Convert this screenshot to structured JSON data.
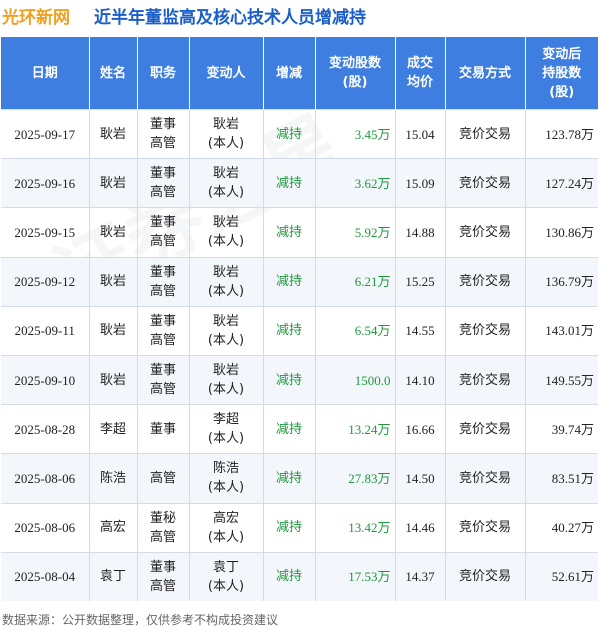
{
  "header": {
    "brand": "光环新网",
    "title": "近半年董监高及核心技术人员增减持"
  },
  "table": {
    "columns": [
      "日期",
      "姓名",
      "职务",
      "变动人",
      "增减",
      "变动股数\n(股)",
      "成交\n均价",
      "交易方式",
      "变动后\n持股数\n(股)"
    ],
    "rows": [
      {
        "date": "2025-09-17",
        "name": "耿岩",
        "role": "董事\n高管",
        "changer": "耿岩\n(本人)",
        "action": "减持",
        "shares": "3.45万",
        "price": "15.04",
        "method": "竞价交易",
        "after": "123.78万"
      },
      {
        "date": "2025-09-16",
        "name": "耿岩",
        "role": "董事\n高管",
        "changer": "耿岩\n(本人)",
        "action": "减持",
        "shares": "3.62万",
        "price": "15.09",
        "method": "竞价交易",
        "after": "127.24万"
      },
      {
        "date": "2025-09-15",
        "name": "耿岩",
        "role": "董事\n高管",
        "changer": "耿岩\n(本人)",
        "action": "减持",
        "shares": "5.92万",
        "price": "14.88",
        "method": "竞价交易",
        "after": "130.86万"
      },
      {
        "date": "2025-09-12",
        "name": "耿岩",
        "role": "董事\n高管",
        "changer": "耿岩\n(本人)",
        "action": "减持",
        "shares": "6.21万",
        "price": "15.25",
        "method": "竞价交易",
        "after": "136.79万"
      },
      {
        "date": "2025-09-11",
        "name": "耿岩",
        "role": "董事\n高管",
        "changer": "耿岩\n(本人)",
        "action": "减持",
        "shares": "6.54万",
        "price": "14.55",
        "method": "竞价交易",
        "after": "143.01万"
      },
      {
        "date": "2025-09-10",
        "name": "耿岩",
        "role": "董事\n高管",
        "changer": "耿岩\n(本人)",
        "action": "减持",
        "shares": "1500.0",
        "price": "14.10",
        "method": "竞价交易",
        "after": "149.55万"
      },
      {
        "date": "2025-08-28",
        "name": "李超",
        "role": "董事",
        "changer": "李超\n(本人)",
        "action": "减持",
        "shares": "13.24万",
        "price": "16.66",
        "method": "竞价交易",
        "after": "39.74万"
      },
      {
        "date": "2025-08-06",
        "name": "陈浩",
        "role": "高管",
        "changer": "陈浩\n(本人)",
        "action": "减持",
        "shares": "27.83万",
        "price": "14.50",
        "method": "竞价交易",
        "after": "83.51万"
      },
      {
        "date": "2025-08-06",
        "name": "高宏",
        "role": "董秘\n高管",
        "changer": "高宏\n(本人)",
        "action": "减持",
        "shares": "13.42万",
        "price": "14.46",
        "method": "竞价交易",
        "after": "40.27万"
      },
      {
        "date": "2025-08-04",
        "name": "袁丁",
        "role": "董事\n高管",
        "changer": "袁丁\n(本人)",
        "action": "减持",
        "shares": "17.53万",
        "price": "14.37",
        "method": "竞价交易",
        "after": "52.61万"
      }
    ]
  },
  "watermark": "证券之星",
  "footer": "数据来源：公开数据整理，仅供参考不构成投资建议",
  "colors": {
    "brand": "#f0a020",
    "title": "#1a5ec8",
    "header_bg": "#3d7ee0",
    "decrease": "#1e9a3c"
  }
}
